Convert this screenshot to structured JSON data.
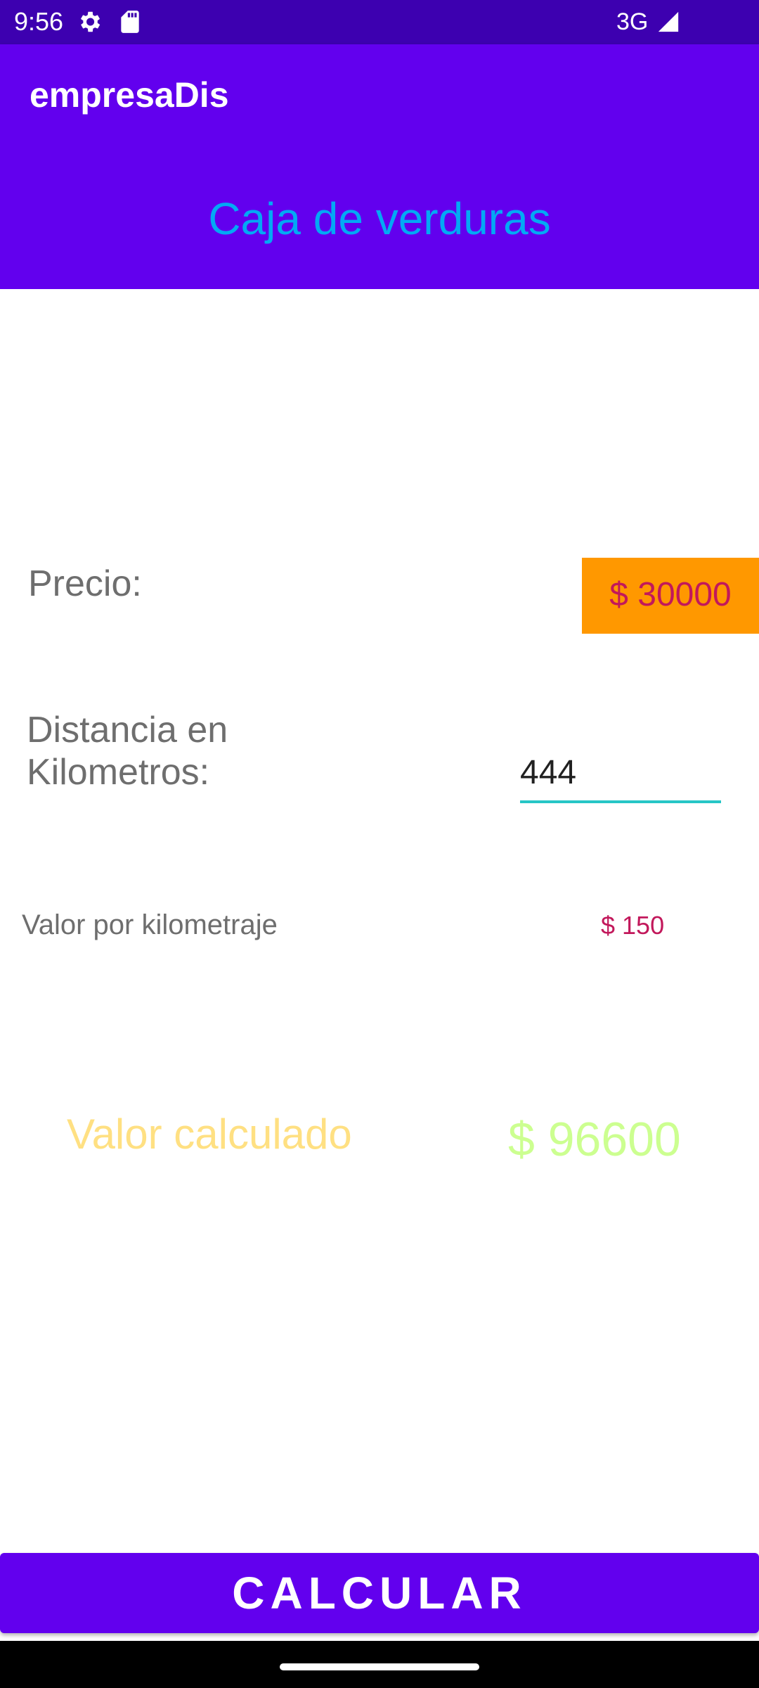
{
  "status_bar": {
    "time": "9:56",
    "network": "3G",
    "icons": [
      "settings-icon",
      "sd-card-icon",
      "signal-icon"
    ]
  },
  "app_bar": {
    "title": "empresaDis"
  },
  "header": {
    "title": "Caja de verduras"
  },
  "form": {
    "price_label": "Precio:",
    "price_value": "$ 30000",
    "distance_label_line1": "Distancia en",
    "distance_label_line2": "Kilometros:",
    "distance_value": "444",
    "rate_label": "Valor por kilometraje",
    "rate_value": "$ 150",
    "calculated_label": "Valor calculado",
    "calculated_value": "$ 96600"
  },
  "actions": {
    "calculate_label": "CALCULAR"
  },
  "colors": {
    "status_bar": "#3d00b0",
    "primary": "#6200ee",
    "header_text": "#03a9f4",
    "price_box": "#ff9800",
    "accent_text": "#c2185b",
    "input_underline": "#26c6c6",
    "calculated_label": "#ffe082",
    "calculated_value": "#ccff90"
  }
}
